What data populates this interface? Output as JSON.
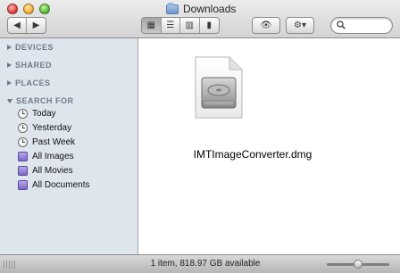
{
  "window": {
    "title": "Downloads",
    "status_text": "1 item, 818.97 GB available"
  },
  "toolbar": {
    "nav": [
      {
        "name": "back",
        "label": "◀"
      },
      {
        "name": "forward",
        "label": "▶"
      }
    ],
    "views": [
      {
        "name": "icon-view",
        "label": "▦",
        "active": true
      },
      {
        "name": "list-view",
        "label": "☰",
        "active": false
      },
      {
        "name": "column-view",
        "label": "▥",
        "active": false
      },
      {
        "name": "coverflow-view",
        "label": "▮",
        "active": false
      }
    ],
    "quicklook_label": "👁",
    "action_label": "⚙▾",
    "search": {
      "placeholder": ""
    }
  },
  "sidebar": {
    "sections": [
      {
        "label": "DEVICES",
        "expanded": false
      },
      {
        "label": "SHARED",
        "expanded": false
      },
      {
        "label": "PLACES",
        "expanded": false
      },
      {
        "label": "SEARCH FOR",
        "expanded": true
      }
    ],
    "search_items": [
      {
        "label": "Today",
        "icon": "clock-icon"
      },
      {
        "label": "Yesterday",
        "icon": "clock-icon"
      },
      {
        "label": "Past Week",
        "icon": "clock-icon"
      },
      {
        "label": "All Images",
        "icon": "smart-folder-icon"
      },
      {
        "label": "All Movies",
        "icon": "smart-folder-icon"
      },
      {
        "label": "All Documents",
        "icon": "smart-folder-icon"
      }
    ]
  },
  "files": [
    {
      "name": "IMTImageConverter.dmg",
      "icon": "disk-image-icon"
    }
  ],
  "statusbar": {
    "zoom_level": 0.5
  },
  "colors": {
    "sidebar_bg": "#dfe5ed",
    "accent": "#6e7a8a"
  }
}
